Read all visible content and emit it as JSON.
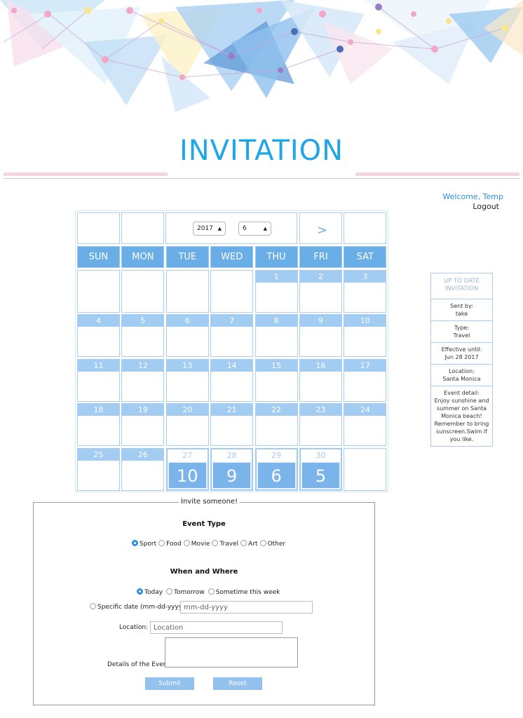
{
  "page": {
    "title": "INVITATION"
  },
  "user": {
    "welcome": "Welcome, Temp",
    "logout": "Logout"
  },
  "calendar": {
    "year": "2017",
    "month": "6",
    "next_label": ">",
    "weekdays": [
      "SUN",
      "MON",
      "TUE",
      "WED",
      "THU",
      "FRI",
      "SAT"
    ],
    "weeks": [
      [
        "",
        "",
        "",
        "",
        "1",
        "2",
        "3"
      ],
      [
        "4",
        "5",
        "6",
        "7",
        "8",
        "9",
        "10"
      ],
      [
        "11",
        "12",
        "13",
        "14",
        "15",
        "16",
        "17"
      ],
      [
        "18",
        "19",
        "20",
        "21",
        "22",
        "23",
        "24"
      ],
      [
        "25",
        "26",
        "27",
        "28",
        "29",
        "30",
        ""
      ]
    ],
    "upcoming_counts": {
      "27": "10",
      "28": "9",
      "29": "6",
      "30": "5"
    }
  },
  "info_panel": {
    "heading": "UP TO DATE INVITATION",
    "sent_by_label": "Sent by:",
    "sent_by": "take",
    "type_label": "Type:",
    "type": "Travel",
    "effective_label": "Effective until:",
    "effective": "Jun 28 2017",
    "location_label": "Location:",
    "location": "Santa Monica",
    "detail_label": "Event detail:",
    "detail": "Enjoy sunshine and summer on Santa Monica beach! Remember to bring sunscreen.Swim if you like."
  },
  "form": {
    "legend": "Invite someone!",
    "event_type_title": "Event Type",
    "event_types": [
      "Sport",
      "Food",
      "Movie",
      "Travel",
      "Art",
      "Other"
    ],
    "event_type_selected": "Sport",
    "when_where_title": "When and Where",
    "when_options": [
      "Today",
      "Tomorrow",
      "Sometime this week"
    ],
    "when_selected": "Today",
    "specific_date_label": "Specific date (mm-dd-yyyy)",
    "specific_date_placeholder": "mm-dd-yyyy",
    "location_label": "Location:",
    "location_placeholder": "Location",
    "details_label": "Details of the Event",
    "submit": "Submit",
    "reset": "Reset"
  }
}
